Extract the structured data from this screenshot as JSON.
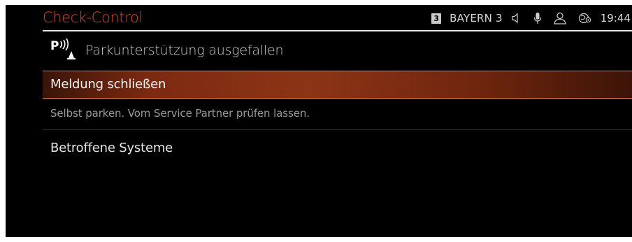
{
  "header": {
    "title": "Check-Control",
    "radio_preset": "3",
    "radio_station": "BAYERN 3",
    "clock": "19:44",
    "icons": [
      "speaker-icon",
      "microphone-icon",
      "profile-icon",
      "connectivity-icon"
    ]
  },
  "message": {
    "icon": "parking-sensor-icon",
    "title": "Parkunterstützung ausgefallen",
    "close_label": "Meldung schließen",
    "description": "Selbst parken. Vom Service Partner prüfen lassen.",
    "affected_label": "Betroffene Systeme"
  },
  "colors": {
    "title_accent": "#e0452a",
    "selection_border": "#e87a3e",
    "selection_fill": "#8d3416",
    "background": "#000000"
  }
}
